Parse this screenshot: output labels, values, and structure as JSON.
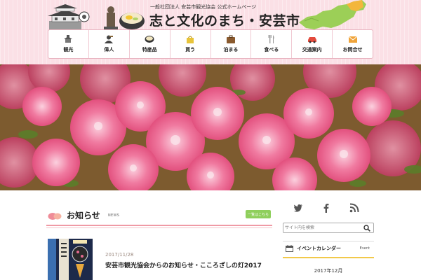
{
  "header": {
    "subtitle": "一般社団法人 安芸市観光協会 公式ホームページ",
    "title": "志と文化のまち・安芸市"
  },
  "nav": {
    "items": [
      {
        "label": "観光",
        "icon": "castle-icon"
      },
      {
        "label": "偉人",
        "icon": "bust-icon"
      },
      {
        "label": "特産品",
        "icon": "bowl-icon"
      },
      {
        "label": "買う",
        "icon": "shopping-bag-icon"
      },
      {
        "label": "泊まる",
        "icon": "suitcase-icon"
      },
      {
        "label": "食べる",
        "icon": "fork-knife-icon"
      },
      {
        "label": "交通案内",
        "icon": "car-icon"
      },
      {
        "label": "お問合せ",
        "icon": "envelope-icon"
      }
    ]
  },
  "news": {
    "title": "お知らせ",
    "subtitle": "NEWS",
    "more_label": "一覧はこちら",
    "items": [
      {
        "date": "2017/11/28",
        "title": "安芸市観光協会からのお知らせ・こころざしの灯2017"
      }
    ]
  },
  "sidebar": {
    "social": [
      {
        "name": "twitter-icon"
      },
      {
        "name": "facebook-icon"
      },
      {
        "name": "rss-icon"
      }
    ],
    "search_placeholder": "サイト内を検索",
    "calendar": {
      "title": "イベントカレンダー",
      "subtitle": "Event",
      "month": "2017年12月"
    }
  },
  "colors": {
    "header_bg": "#fbe0e6",
    "accent_pink": "#ef9aa5",
    "more_button": "#8fcf5c",
    "calendar_rule": "#f2c94a"
  }
}
